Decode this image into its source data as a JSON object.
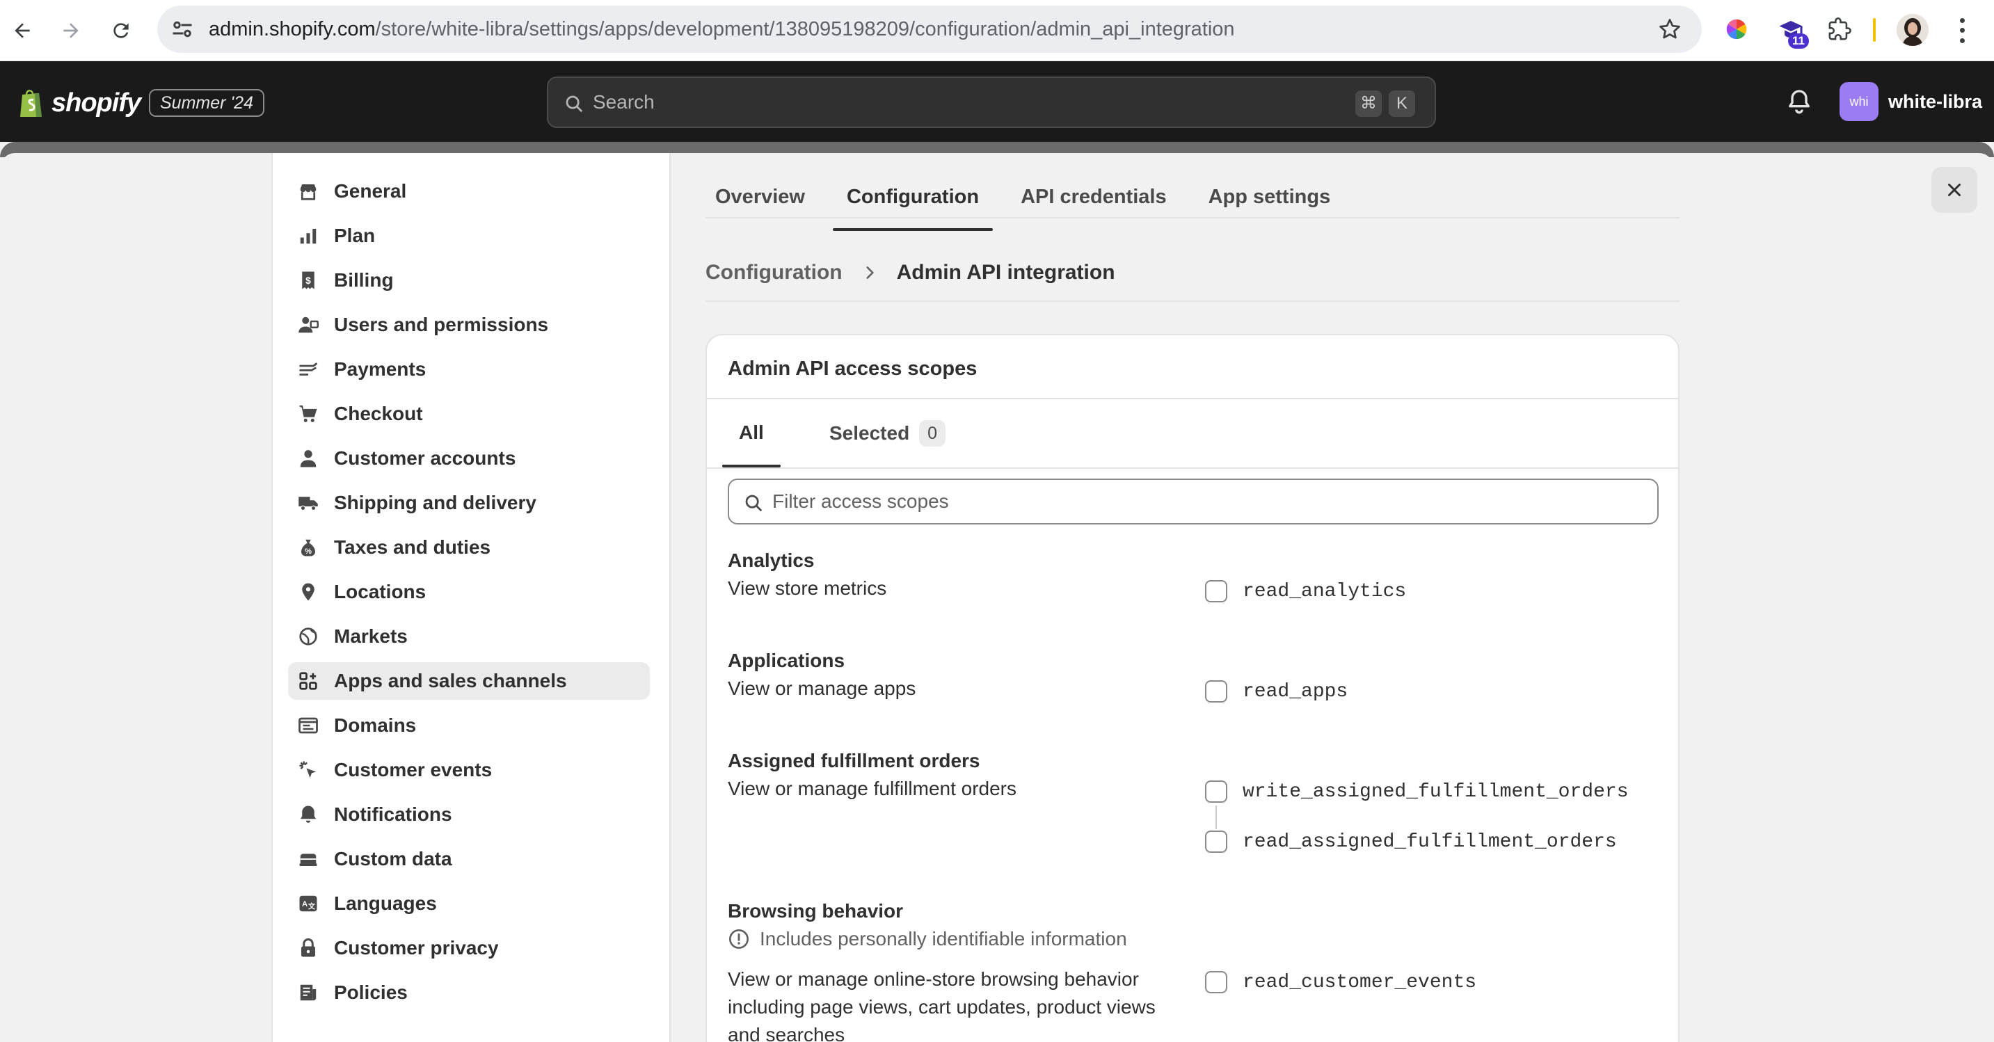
{
  "browser": {
    "url_host": "admin.shopify.com",
    "url_path": "/store/white-libra/settings/apps/development/138095198209/configuration/admin_api_integration",
    "extension_badge": "11"
  },
  "topbar": {
    "logo_text": "shopify",
    "season_badge": "Summer '24",
    "search_placeholder": "Search",
    "shortcut_key1": "⌘",
    "shortcut_key2": "K",
    "store_avatar": "whi",
    "store_name": "white-libra"
  },
  "sidebar": {
    "items": [
      {
        "label": "General",
        "icon": "store-icon"
      },
      {
        "label": "Plan",
        "icon": "plan-icon"
      },
      {
        "label": "Billing",
        "icon": "billing-icon"
      },
      {
        "label": "Users and permissions",
        "icon": "users-icon"
      },
      {
        "label": "Payments",
        "icon": "payments-icon"
      },
      {
        "label": "Checkout",
        "icon": "cart-icon"
      },
      {
        "label": "Customer accounts",
        "icon": "person-icon"
      },
      {
        "label": "Shipping and delivery",
        "icon": "truck-icon"
      },
      {
        "label": "Taxes and duties",
        "icon": "tax-icon"
      },
      {
        "label": "Locations",
        "icon": "location-icon"
      },
      {
        "label": "Markets",
        "icon": "globe-icon"
      },
      {
        "label": "Apps and sales channels",
        "icon": "apps-icon"
      },
      {
        "label": "Domains",
        "icon": "domains-icon"
      },
      {
        "label": "Customer events",
        "icon": "cursor-icon"
      },
      {
        "label": "Notifications",
        "icon": "bell-icon"
      },
      {
        "label": "Custom data",
        "icon": "database-icon"
      },
      {
        "label": "Languages",
        "icon": "language-icon"
      },
      {
        "label": "Customer privacy",
        "icon": "lock-icon"
      },
      {
        "label": "Policies",
        "icon": "policy-icon"
      }
    ],
    "active_item": "Apps and sales channels"
  },
  "tabs": [
    "Overview",
    "Configuration",
    "API credentials",
    "App settings"
  ],
  "active_tab": "Configuration",
  "breadcrumb": {
    "parent": "Configuration",
    "current": "Admin API integration"
  },
  "card": {
    "title": "Admin API access scopes",
    "tab_all": "All",
    "tab_selected": "Selected",
    "selected_count": "0",
    "filter_placeholder": "Filter access scopes"
  },
  "sections": [
    {
      "title": "Analytics",
      "desc": "View store metrics",
      "scopes": [
        "read_analytics"
      ]
    },
    {
      "title": "Applications",
      "desc": "View or manage apps",
      "scopes": [
        "read_apps"
      ]
    },
    {
      "title": "Assigned fulfillment orders",
      "desc": "View or manage fulfillment orders",
      "scopes": [
        "write_assigned_fulfillment_orders",
        "read_assigned_fulfillment_orders"
      ]
    },
    {
      "title": "Browsing behavior",
      "pii_note": "Includes personally identifiable information",
      "desc": "View or manage online-store browsing behavior including page views, cart updates, product views and searches",
      "scopes": [
        "read_customer_events"
      ]
    }
  ]
}
